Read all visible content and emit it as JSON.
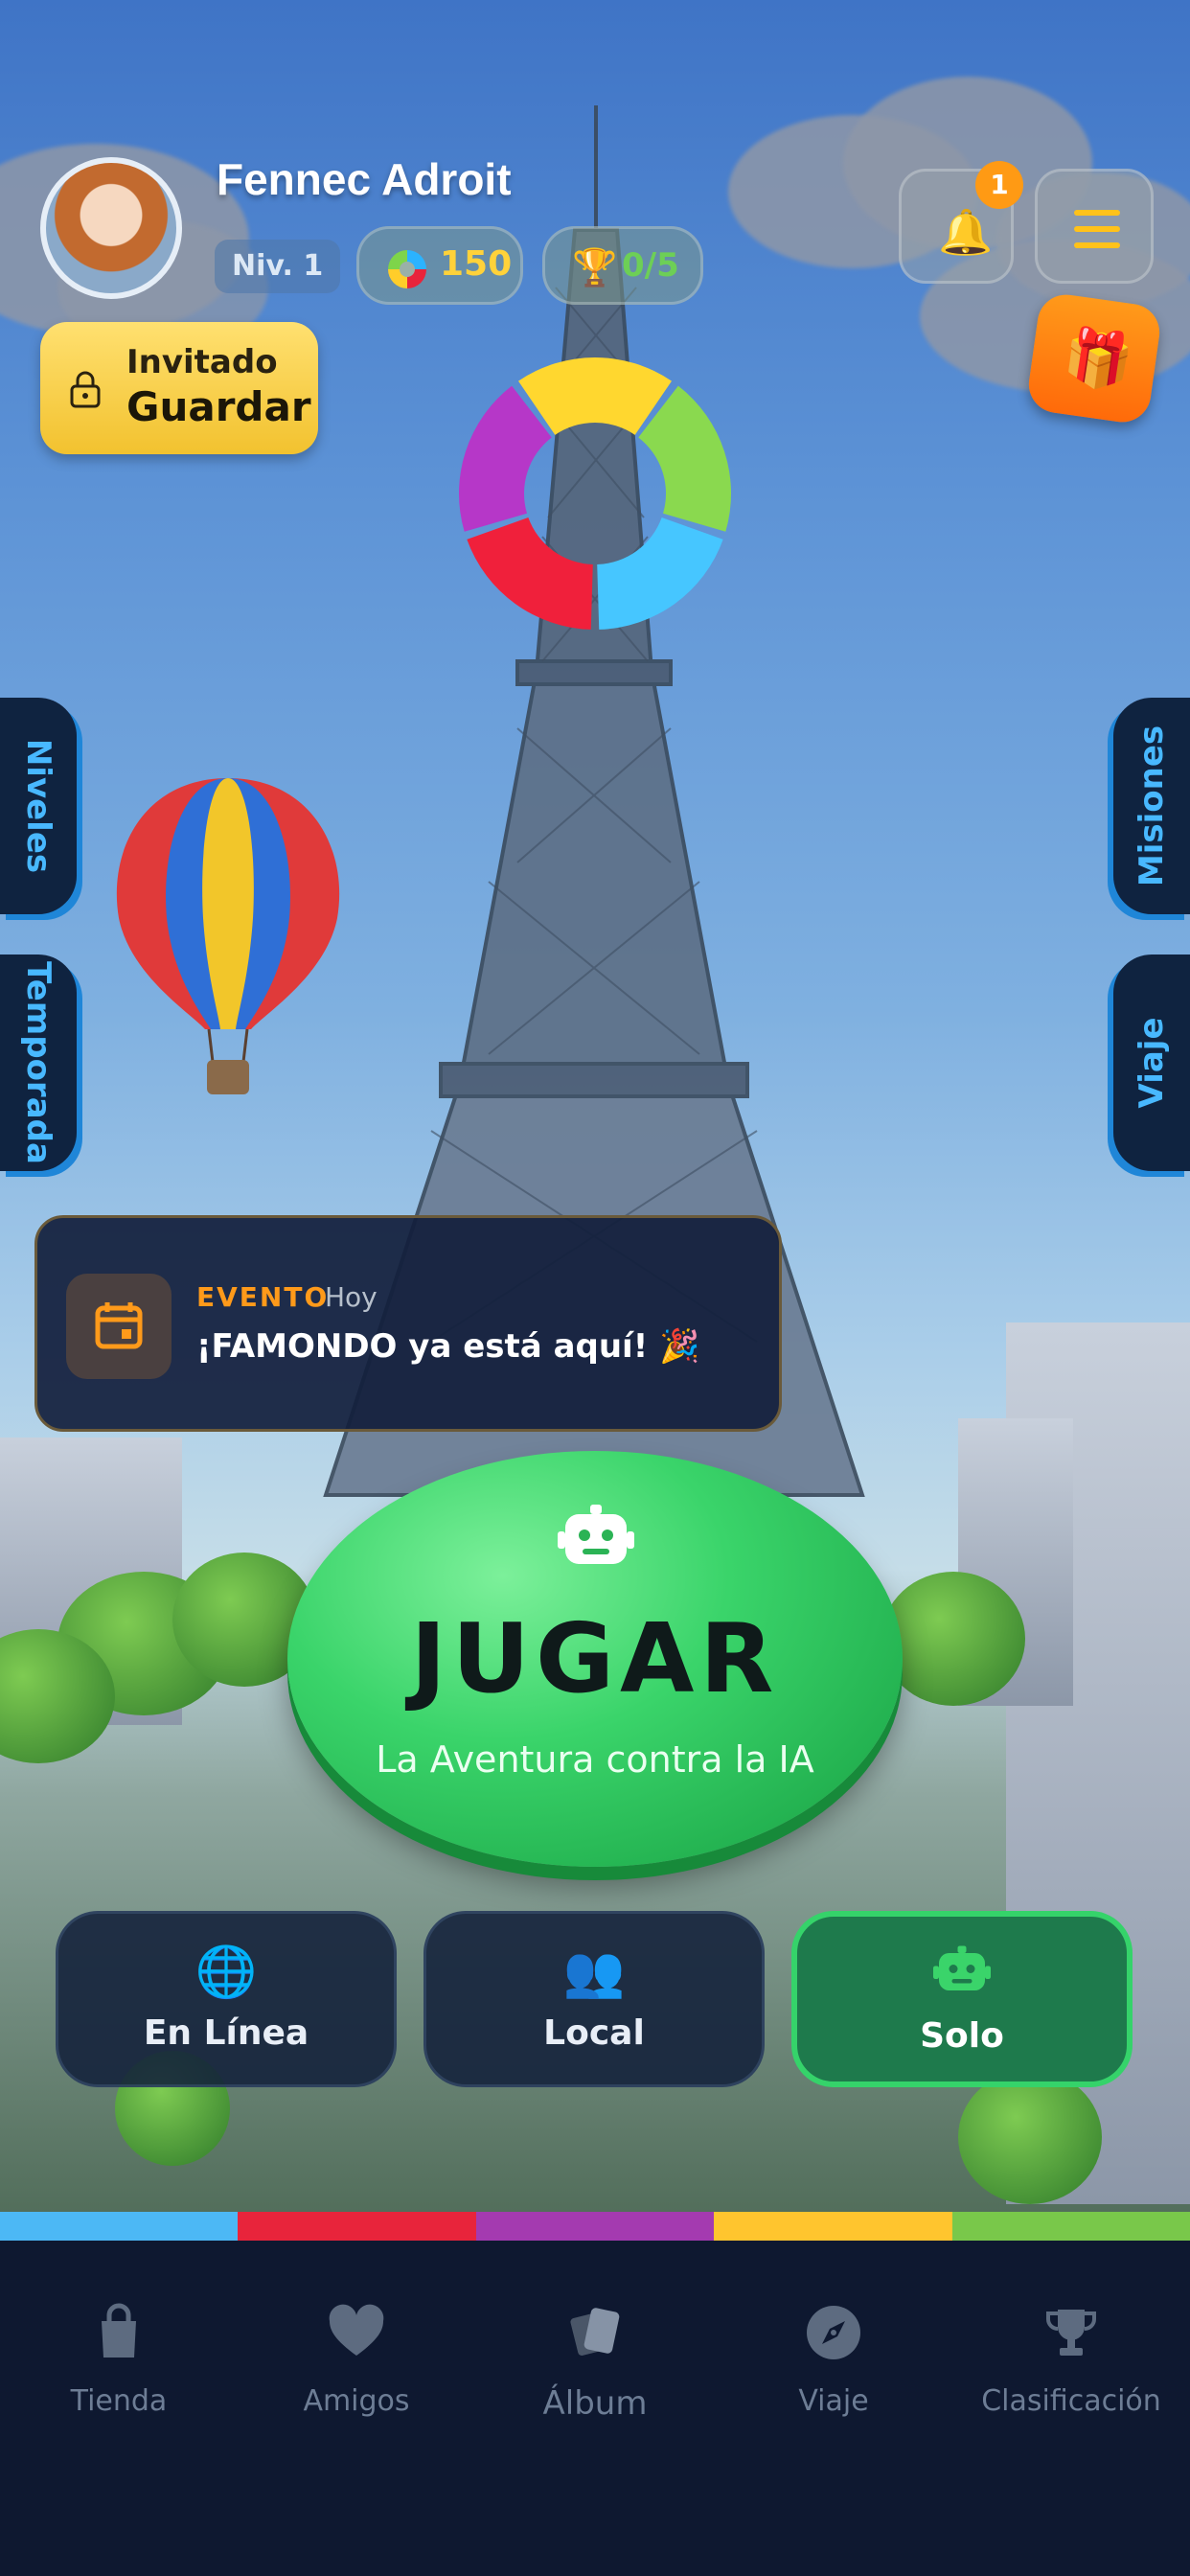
{
  "header": {
    "username": "Fennec Adroit",
    "level": "Niv. 1",
    "coins": "150",
    "trophies": "0/5",
    "notification_count": "1"
  },
  "guest": {
    "line1": "Invitado",
    "line2": "Guardar"
  },
  "side_tabs": {
    "left": [
      "Niveles",
      "Temporada"
    ],
    "right": [
      "Misiones",
      "Viaje"
    ]
  },
  "event": {
    "tag": "EVENTO",
    "when": "Hoy",
    "text": "¡FAMONDO ya está aquí! 🎉"
  },
  "play": {
    "title": "JUGAR",
    "subtitle": "La Aventura contra la IA"
  },
  "modes": [
    {
      "label": "En Línea",
      "icon": "globe-icon",
      "active": false
    },
    {
      "label": "Local",
      "icon": "people-icon",
      "active": false
    },
    {
      "label": "Solo",
      "icon": "robot-icon",
      "active": true
    }
  ],
  "color_bar": [
    "#4cb8f5",
    "#e8243b",
    "#a43ab0",
    "#ffc52e",
    "#79c84a"
  ],
  "wheel_colors": [
    "#ffd72f",
    "#8ad94f",
    "#46c6ff",
    "#f0203b",
    "#b637c8"
  ],
  "bottom_nav": [
    {
      "label": "Tienda",
      "icon": "shopping-bag-icon"
    },
    {
      "label": "Amigos",
      "icon": "heart-icon"
    },
    {
      "label": "Álbum",
      "icon": "cards-icon"
    },
    {
      "label": "Viaje",
      "icon": "compass-icon"
    },
    {
      "label": "Clasificación",
      "icon": "trophy-icon"
    }
  ]
}
